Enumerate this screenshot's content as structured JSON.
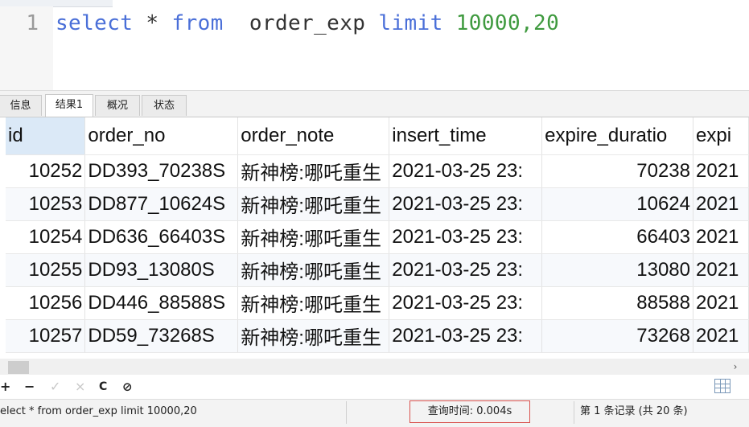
{
  "editor": {
    "line_number": "1",
    "tokens": {
      "kw1": "select",
      "star": "*",
      "kw2": "from",
      "table": "order_exp",
      "kw3": "limit",
      "num": "10000,20"
    }
  },
  "tabs": [
    {
      "label": "信息"
    },
    {
      "label": "结果1"
    },
    {
      "label": "概况"
    },
    {
      "label": "状态"
    }
  ],
  "grid": {
    "columns": [
      "id",
      "order_no",
      "order_note",
      "insert_time",
      "expire_duratio",
      "expi"
    ],
    "rows": [
      [
        "10252",
        "DD393_70238S",
        "新神榜:哪吒重生",
        "2021-03-25 23:",
        "70238",
        "2021"
      ],
      [
        "10253",
        "DD877_10624S",
        "新神榜:哪吒重生",
        "2021-03-25 23:",
        "10624",
        "2021"
      ],
      [
        "10254",
        "DD636_66403S",
        "新神榜:哪吒重生",
        "2021-03-25 23:",
        "66403",
        "2021"
      ],
      [
        "10255",
        "DD93_13080S",
        "新神榜:哪吒重生",
        "2021-03-25 23:",
        "13080",
        "2021"
      ],
      [
        "10256",
        "DD446_88588S",
        "新神榜:哪吒重生",
        "2021-03-25 23:",
        "88588",
        "2021"
      ],
      [
        "10257",
        "DD59_73268S",
        "新神榜:哪吒重生",
        "2021-03-25 23:",
        "73268",
        "2021"
      ]
    ]
  },
  "toolbar": {
    "add_icon": "+",
    "delete_icon": "−",
    "apply_icon": "✓",
    "discard_icon": "×",
    "refresh_icon": "C",
    "stop_icon": "⊘"
  },
  "status": {
    "sql": "elect * from  order_exp limit 10000,20",
    "query_time": "查询时间: 0.004s",
    "records": "第 1 条记录 (共 20 条)"
  }
}
